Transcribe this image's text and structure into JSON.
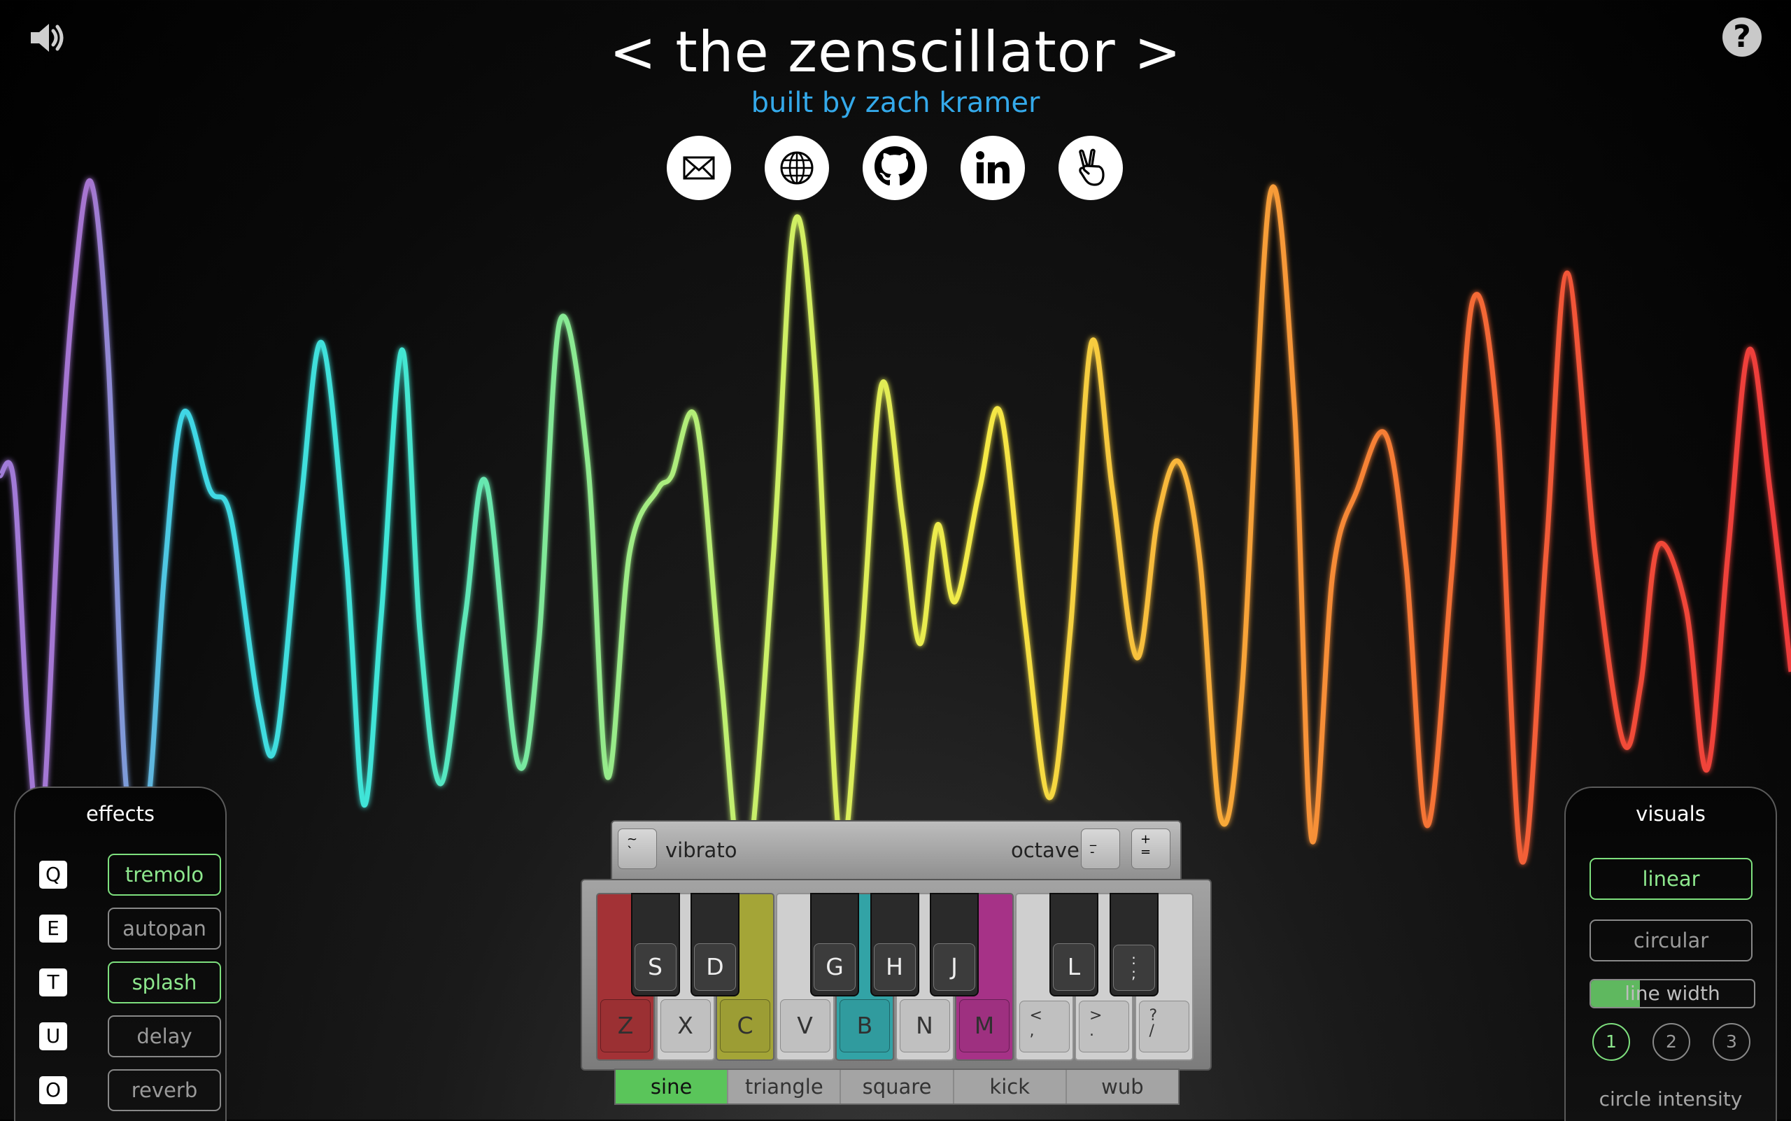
{
  "header": {
    "title": "< the zenscillator >",
    "subtitle": "built by zach kramer"
  },
  "toolbar": {
    "sound_icon": "speaker-icon",
    "help_label": "?"
  },
  "links": [
    {
      "icon": "mail-icon"
    },
    {
      "icon": "globe-icon"
    },
    {
      "icon": "github-icon"
    },
    {
      "icon": "linkedin-icon"
    },
    {
      "icon": "angellist-icon"
    }
  ],
  "effects": {
    "title": "effects",
    "items": [
      {
        "key": "Q",
        "label": "tremolo",
        "active": true
      },
      {
        "key": "E",
        "label": "autopan",
        "active": false
      },
      {
        "key": "T",
        "label": "splash",
        "active": true
      },
      {
        "key": "U",
        "label": "delay",
        "active": false
      },
      {
        "key": "O",
        "label": "reverb",
        "active": false
      }
    ]
  },
  "visuals": {
    "title": "visuals",
    "modes": [
      {
        "label": "linear",
        "active": true
      },
      {
        "label": "circular",
        "active": false
      }
    ],
    "line_width": {
      "label": "line width",
      "value": 0.3
    },
    "circle_intensity": {
      "label": "circle intensity",
      "options": [
        "1",
        "2",
        "3"
      ],
      "selected": "1"
    }
  },
  "keyboard": {
    "vibrato": {
      "key_top": "~",
      "key_bottom": "`",
      "label": "vibrato"
    },
    "octave": {
      "label": "octave",
      "down": {
        "top": "_",
        "bottom": "-"
      },
      "up": {
        "top": "+",
        "bottom": "="
      }
    },
    "white_keys": [
      {
        "label": "Z",
        "color": "#a33236"
      },
      {
        "label": "X",
        "color": ""
      },
      {
        "label": "C",
        "color": "#a4a537"
      },
      {
        "label": "V",
        "color": ""
      },
      {
        "label": "B",
        "color": "#32a3a6"
      },
      {
        "label": "N",
        "color": ""
      },
      {
        "label": "M",
        "color": "#a63287"
      },
      {
        "label": "<\n,",
        "color": ""
      },
      {
        "label": ">\n.",
        "color": ""
      },
      {
        "label": "?\n/",
        "color": ""
      }
    ],
    "black_keys": [
      "S",
      "D",
      "G",
      "H",
      "J",
      "L",
      ":\n;"
    ],
    "waveforms": [
      {
        "label": "sine",
        "active": true
      },
      {
        "label": "triangle",
        "active": false
      },
      {
        "label": "square",
        "active": false
      },
      {
        "label": "kick",
        "active": false
      },
      {
        "label": "wub",
        "active": false
      }
    ]
  },
  "colors": {
    "accent_green": "#7ee07e",
    "subtitle_blue": "#34a9ea"
  }
}
